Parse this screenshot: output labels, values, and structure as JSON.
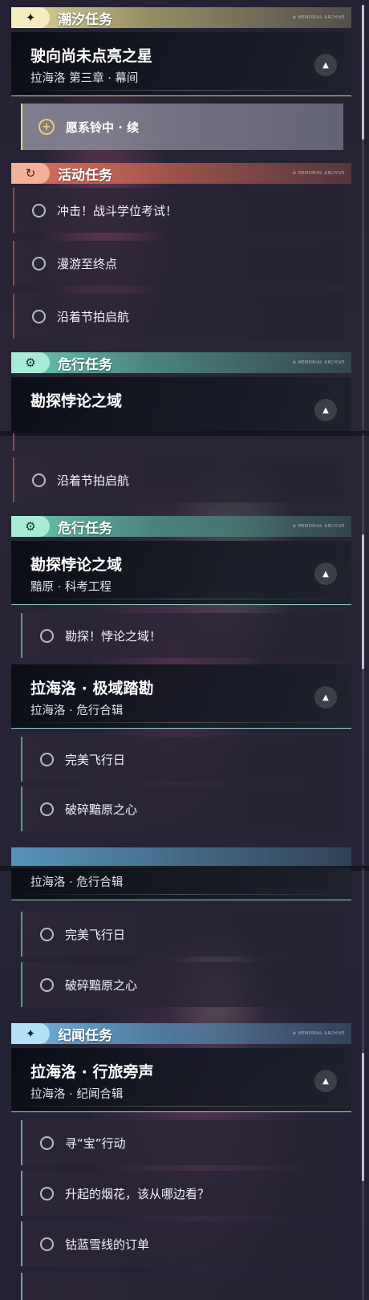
{
  "sections": {
    "tide": {
      "title": "潮汐任务",
      "icon": "sparkle-icon",
      "accent": "#e9dea0"
    },
    "event": {
      "title": "活动任务",
      "icon": "refresh-icon",
      "accent": "#e27f62"
    },
    "danger": {
      "title": "危行任务",
      "icon": "gear-icon",
      "accent": "#7fd6c0"
    },
    "lore": {
      "title": "纪闻任务",
      "icon": "sparkle-icon",
      "accent": "#7fc2ea"
    },
    "tag": "⊕ MEMORIAL ARCHIVE"
  },
  "quests": {
    "star": {
      "title": "驶向尚未点亮之星",
      "subtitle": "拉海洛 第三章 · 幕间"
    },
    "paradox": {
      "title": "勘探悖论之域",
      "subtitle": "黯原 · 科考工程"
    },
    "polar": {
      "title": "拉海洛 · 极域踏勘",
      "subtitle": "拉海洛 · 危行合辑"
    },
    "travel": {
      "title": "拉海洛 · 行旅旁声",
      "subtitle": "拉海洛 · 纪闻合辑"
    }
  },
  "tasks": {
    "bell": "愿系铃中 · 续",
    "exam": "冲击！战斗学位考试！",
    "roam": "漫游至终点",
    "sail": "沿着节拍启航",
    "explore": "勘探！悖论之域！",
    "flight": "完美飞行日",
    "heart": "破碎黯原之心",
    "treasure": "寻“宝”行动",
    "fireworks": "升起的烟花，该从哪边看？",
    "order": "钴蓝雪线的订单"
  },
  "ui": {
    "collapse_glyph": "▲",
    "plus_glyph": "+"
  }
}
